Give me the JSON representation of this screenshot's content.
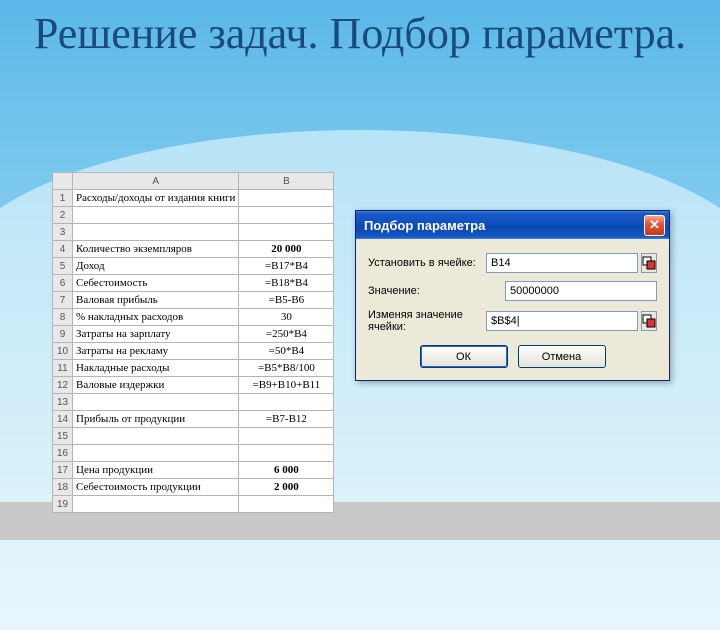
{
  "slide": {
    "title": "Решение задач. Подбор параметра."
  },
  "sheet": {
    "colA": "A",
    "colB": "B",
    "rows": [
      {
        "n": "1",
        "a": "Расходы/доходы от издания книги",
        "b": ""
      },
      {
        "n": "2",
        "a": "",
        "b": ""
      },
      {
        "n": "3",
        "a": "",
        "b": ""
      },
      {
        "n": "4",
        "a": "Количество экземпляров",
        "b": "20 000",
        "bold": true
      },
      {
        "n": "5",
        "a": "Доход",
        "b": "=B17*B4"
      },
      {
        "n": "6",
        "a": "Себестоимость",
        "b": "=B18*B4"
      },
      {
        "n": "7",
        "a": "Валовая прибыль",
        "b": "=B5-B6"
      },
      {
        "n": "8",
        "a": "% накладных расходов",
        "b": "30"
      },
      {
        "n": "9",
        "a": "Затраты на зарплату",
        "b": "=250*B4"
      },
      {
        "n": "10",
        "a": "Затраты на рекламу",
        "b": "=50*B4"
      },
      {
        "n": "11",
        "a": "Накладные расходы",
        "b": "=B5*B8/100"
      },
      {
        "n": "12",
        "a": "Валовые издержки",
        "b": "=B9+B10+B11"
      },
      {
        "n": "13",
        "a": "",
        "b": ""
      },
      {
        "n": "14",
        "a": "Прибыль от продукции",
        "b": "=B7-B12"
      },
      {
        "n": "15",
        "a": "",
        "b": ""
      },
      {
        "n": "16",
        "a": "",
        "b": ""
      },
      {
        "n": "17",
        "a": "Цена продукции",
        "b": "6 000",
        "bold": true
      },
      {
        "n": "18",
        "a": "Себестоимость продукции",
        "b": "2 000",
        "bold": true
      },
      {
        "n": "19",
        "a": "",
        "b": ""
      }
    ]
  },
  "dialog": {
    "title": "Подбор параметра",
    "label_setcell": "Установить в ячейке:",
    "label_value": "Значение:",
    "label_changing": "Изменяя значение ячейки:",
    "field_setcell": "B14",
    "field_value": "50000000",
    "field_changing": "$B$4|",
    "btn_ok": "ОК",
    "btn_cancel": "Отмена"
  }
}
